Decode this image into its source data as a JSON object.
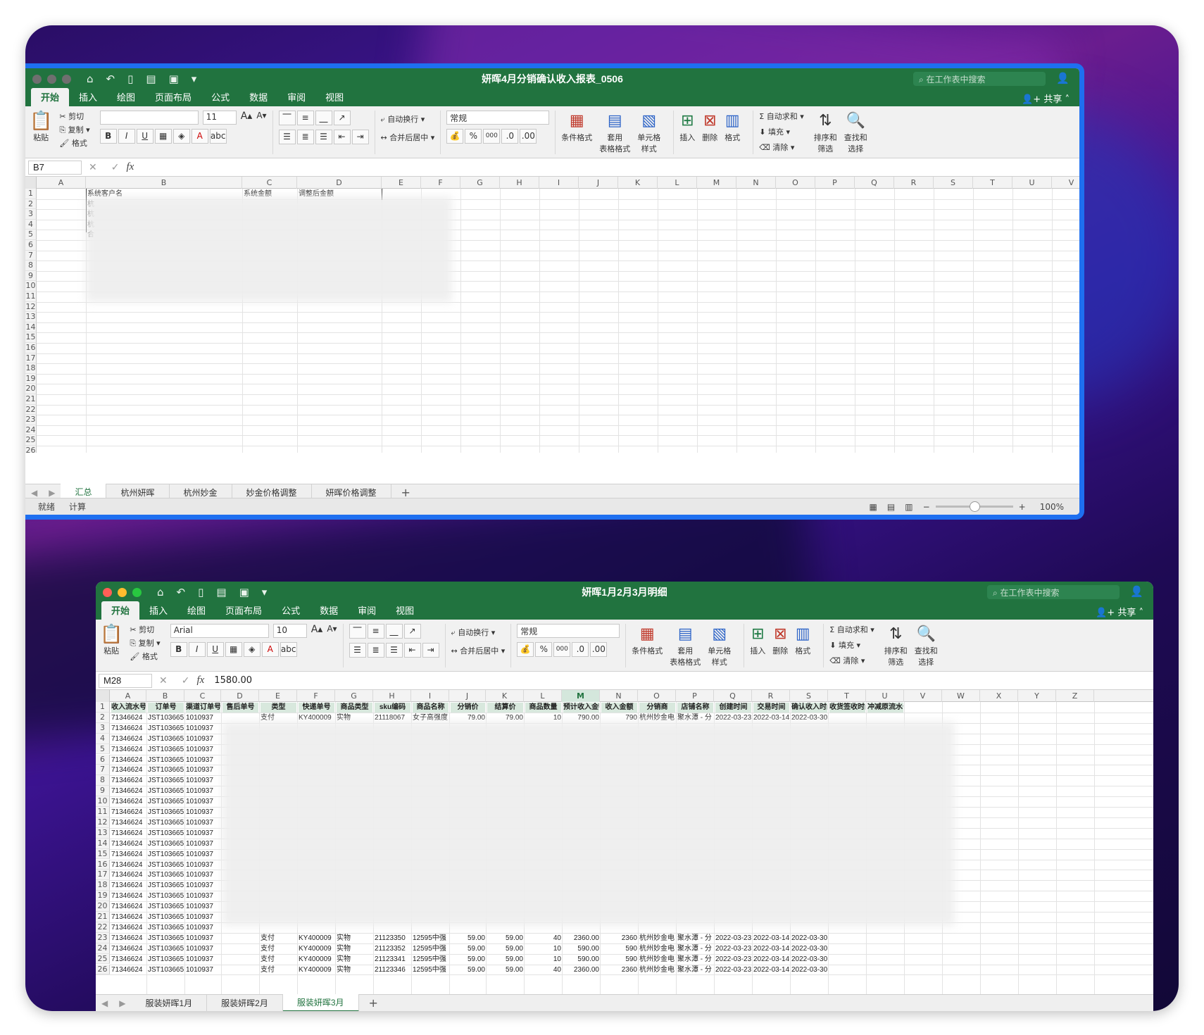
{
  "ribbon_tabs": [
    "开始",
    "插入",
    "绘图",
    "页面布局",
    "公式",
    "数据",
    "审阅",
    "视图"
  ],
  "share_label": "共享",
  "search_placeholder": "在工作表中搜索",
  "ribbon": {
    "paste": "粘贴",
    "cut": "剪切",
    "copy": "复制",
    "format_painter": "格式",
    "wrap": "自动换行",
    "merge": "合并后居中",
    "number_format": "常规",
    "cond_format": "条件格式",
    "table_format_1": "套用",
    "table_format_2": "表格格式",
    "cell_style_1": "单元格",
    "cell_style_2": "样式",
    "insert": "插入",
    "delete": "删除",
    "format": "格式",
    "autosum": "自动求和",
    "fill": "填充",
    "clear": "清除",
    "sort_1": "排序和",
    "sort_2": "筛选",
    "find_1": "查找和",
    "find_2": "选择",
    "bold": "B",
    "italic": "I",
    "underline": "U",
    "percent": "%",
    "thousands": "000"
  },
  "win1": {
    "title": "妍晖4月分销确认收入报表_0506",
    "font_name": "",
    "font_size": "11",
    "name_box": "B7",
    "formula": "",
    "columns": [
      "A",
      "B",
      "C",
      "D",
      "E",
      "F",
      "G",
      "H",
      "I",
      "J",
      "K",
      "L",
      "M",
      "N",
      "O",
      "P",
      "Q",
      "R",
      "S",
      "T",
      "U",
      "V"
    ],
    "row_count": 26,
    "visible_cells": {
      "B1": "系统客户名",
      "C1": "系统金额",
      "D1": "调整后金额",
      "B2": "杭",
      "B3": "杭",
      "B4": "杭",
      "B5": "合"
    },
    "sheets": [
      "汇总",
      "杭州妍晖",
      "杭州妙金",
      "妙金价格调整",
      "妍晖价格调整"
    ],
    "active_sheet": 0,
    "status_left": "就绪",
    "status_calc": "计算",
    "zoom": "100%"
  },
  "win2": {
    "title": "妍晖1月2月3月明细",
    "font_name": "Arial",
    "font_size": "10",
    "name_box": "M28",
    "formula": "1580.00",
    "columns": [
      "A",
      "B",
      "C",
      "D",
      "E",
      "F",
      "G",
      "H",
      "I",
      "J",
      "K",
      "L",
      "M",
      "N",
      "O",
      "P",
      "Q",
      "R",
      "S",
      "T",
      "U",
      "V",
      "W",
      "X",
      "Y",
      "Z"
    ],
    "headers": [
      "收入流水号",
      "订单号",
      "渠道订单号",
      "售后单号",
      "类型",
      "快递单号",
      "商品类型",
      "sku编码",
      "商品名称",
      "分销价",
      "结算价",
      "商品数量",
      "预计收入金额",
      "收入金额",
      "分销商",
      "店铺名称",
      "创建时间",
      "交易时间",
      "确认收入时间",
      "收货签收时间",
      "冲减原流水号"
    ],
    "row2": [
      "71346624",
      "JST103665",
      "1010937",
      "",
      "支付",
      "KY400009",
      "实物",
      "21118067",
      "女子高强度",
      "79.00",
      "79.00",
      "10",
      "790.00",
      "790",
      "杭州妙金电",
      "聚水潭 - 分",
      "2022-03-23",
      "2022-03-14",
      "2022-03-30",
      "",
      ""
    ],
    "common": {
      "a": "71346624",
      "b": "JST103665",
      "c": "1010937"
    },
    "bottom_rows": [
      [
        "支付",
        "KY400009",
        "实物",
        "21123350",
        "12595中强",
        "59.00",
        "59.00",
        "40",
        "2360.00",
        "2360",
        "杭州妙金电",
        "聚水潭 - 分",
        "2022-03-23",
        "2022-03-14",
        "2022-03-30"
      ],
      [
        "支付",
        "KY400009",
        "实物",
        "21123352",
        "12595中强",
        "59.00",
        "59.00",
        "10",
        "590.00",
        "590",
        "杭州妙金电",
        "聚水潭 - 分",
        "2022-03-23",
        "2022-03-14",
        "2022-03-30"
      ],
      [
        "支付",
        "KY400009",
        "实物",
        "21123341",
        "12595中强",
        "59.00",
        "59.00",
        "10",
        "590.00",
        "590",
        "杭州妙金电",
        "聚水潭 - 分",
        "2022-03-23",
        "2022-03-14",
        "2022-03-30"
      ],
      [
        "支付",
        "KY400009",
        "实物",
        "21123346",
        "12595中强",
        "59.00",
        "59.00",
        "40",
        "2360.00",
        "2360",
        "杭州妙金电",
        "聚水潭 - 分",
        "2022-03-23",
        "2022-03-14",
        "2022-03-30"
      ]
    ],
    "sheets": [
      "服装妍晖1月",
      "服装妍晖2月",
      "服装妍晖3月"
    ],
    "active_sheet": 2
  },
  "colors": {
    "excel_green": "#21733f",
    "selection_blue": "#1e6ff0"
  }
}
